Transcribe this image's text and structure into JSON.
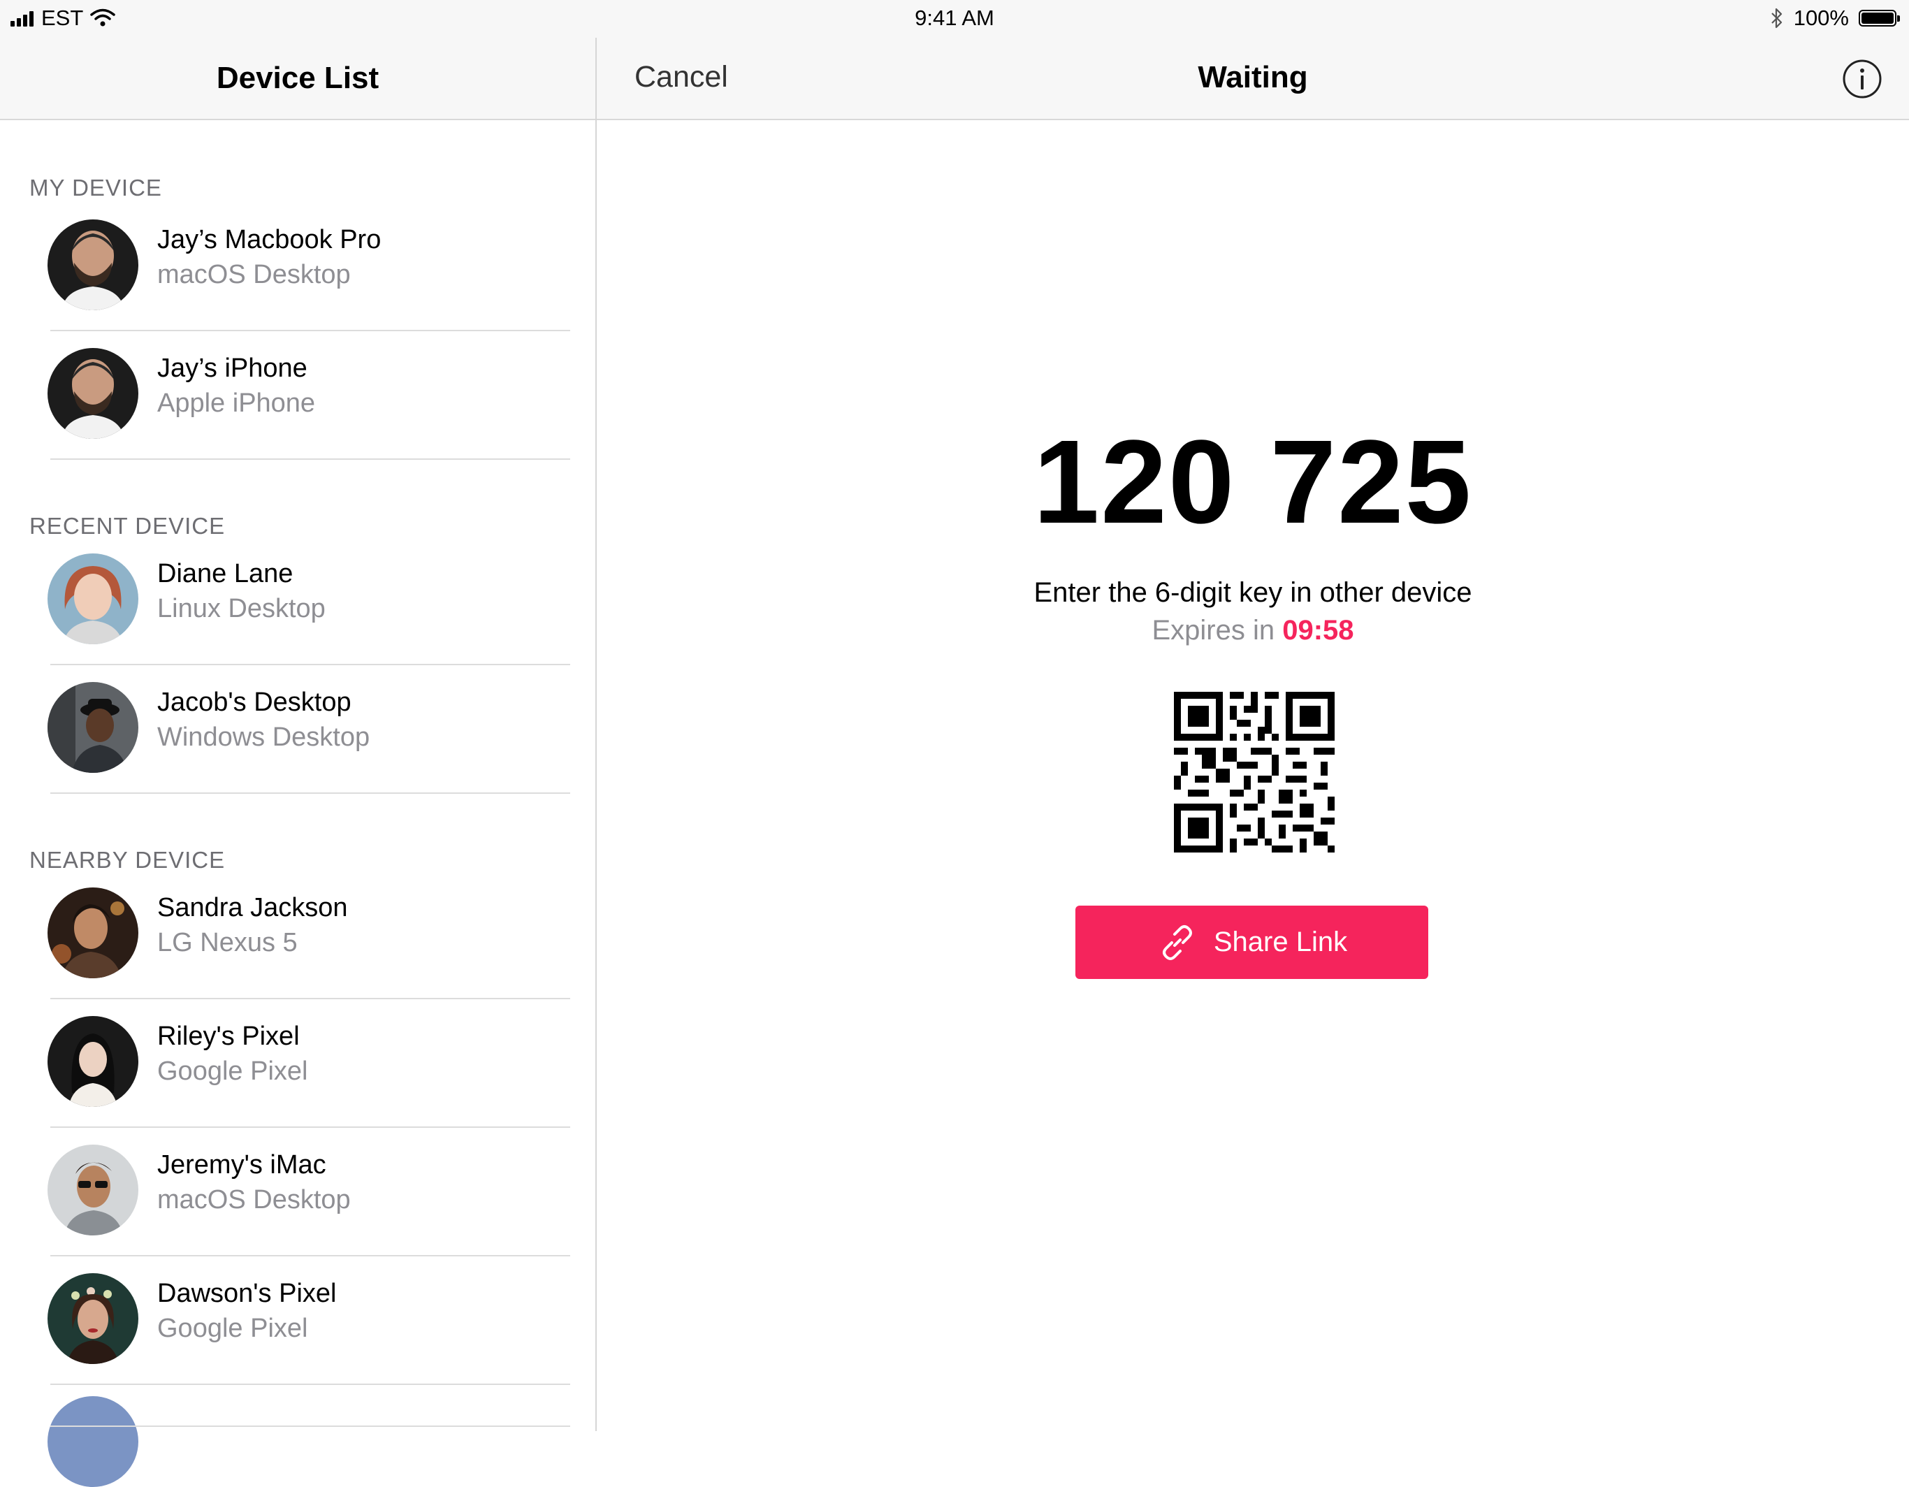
{
  "status_bar": {
    "carrier": "EST",
    "time": "9:41 AM",
    "battery": "100%",
    "battery_level": 1.0,
    "icons": [
      "signal-icon",
      "wifi-icon",
      "bluetooth-icon",
      "battery-icon"
    ]
  },
  "sidebar": {
    "title": "Device List",
    "sections": [
      {
        "header": "MY DEVICE",
        "items": [
          {
            "name": "Jay’s Macbook Pro",
            "subtitle": "macOS Desktop"
          },
          {
            "name": "Jay’s iPhone",
            "subtitle": "Apple iPhone"
          }
        ]
      },
      {
        "header": "RECENT DEVICE",
        "items": [
          {
            "name": "Diane Lane",
            "subtitle": "Linux Desktop"
          },
          {
            "name": "Jacob's Desktop",
            "subtitle": "Windows Desktop"
          }
        ]
      },
      {
        "header": "NEARBY DEVICE",
        "items": [
          {
            "name": "Sandra Jackson",
            "subtitle": "LG Nexus 5"
          },
          {
            "name": "Riley's Pixel",
            "subtitle": "Google Pixel"
          },
          {
            "name": "Jeremy's iMac",
            "subtitle": "macOS Desktop"
          },
          {
            "name": "Dawson's Pixel",
            "subtitle": "Google Pixel"
          }
        ]
      }
    ]
  },
  "main": {
    "cancel_label": "Cancel",
    "title": "Waiting",
    "code": "120 725",
    "instruction": "Enter the 6-digit key in other device",
    "expires_prefix": "Expires in ",
    "expires_time": "09:58",
    "share_label": "Share Link"
  },
  "colors": {
    "accent": "#f5245c",
    "secondary_text": "#8e8e93",
    "bar_background": "#f7f7f7"
  }
}
